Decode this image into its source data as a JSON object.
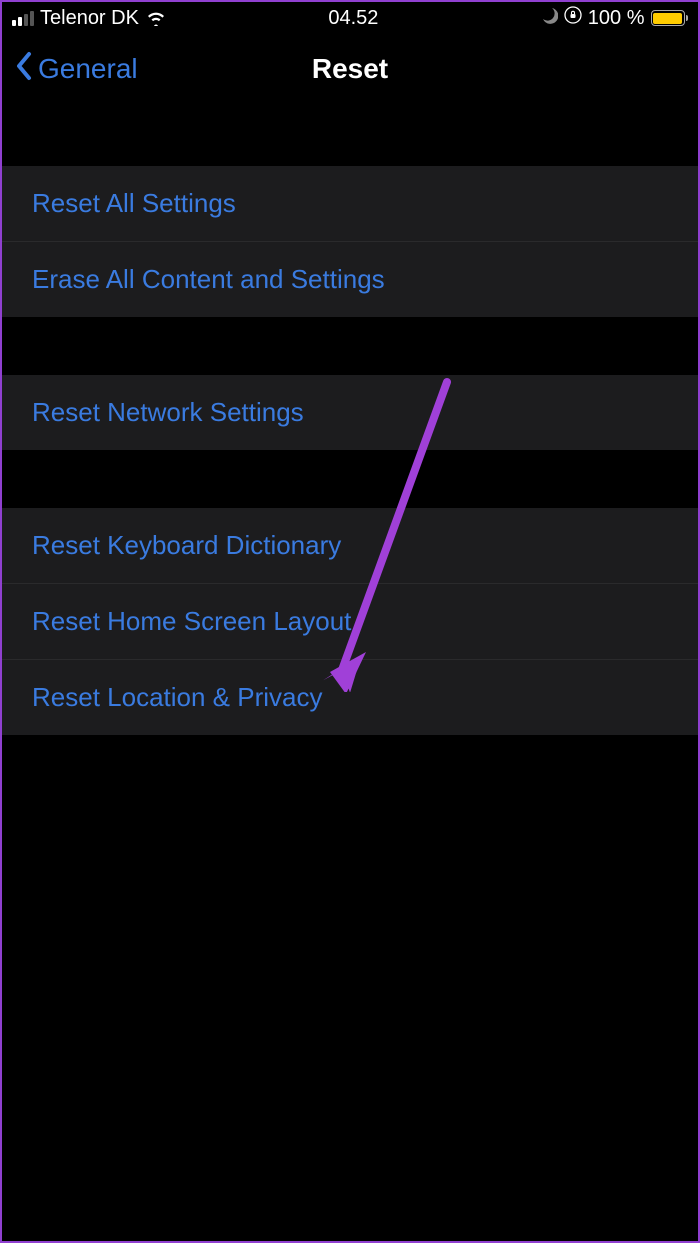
{
  "status_bar": {
    "carrier": "Telenor DK",
    "time": "04.52",
    "battery_text": "100 %"
  },
  "nav": {
    "back_label": "General",
    "title": "Reset"
  },
  "groups": [
    {
      "items": [
        {
          "label": "Reset All Settings"
        },
        {
          "label": "Erase All Content and Settings"
        }
      ]
    },
    {
      "items": [
        {
          "label": "Reset Network Settings"
        }
      ]
    },
    {
      "items": [
        {
          "label": "Reset Keyboard Dictionary"
        },
        {
          "label": "Reset Home Screen Layout"
        },
        {
          "label": "Reset Location & Privacy"
        }
      ]
    }
  ],
  "annotation": {
    "color": "#a040d8",
    "target_item": "Reset Location & Privacy"
  }
}
